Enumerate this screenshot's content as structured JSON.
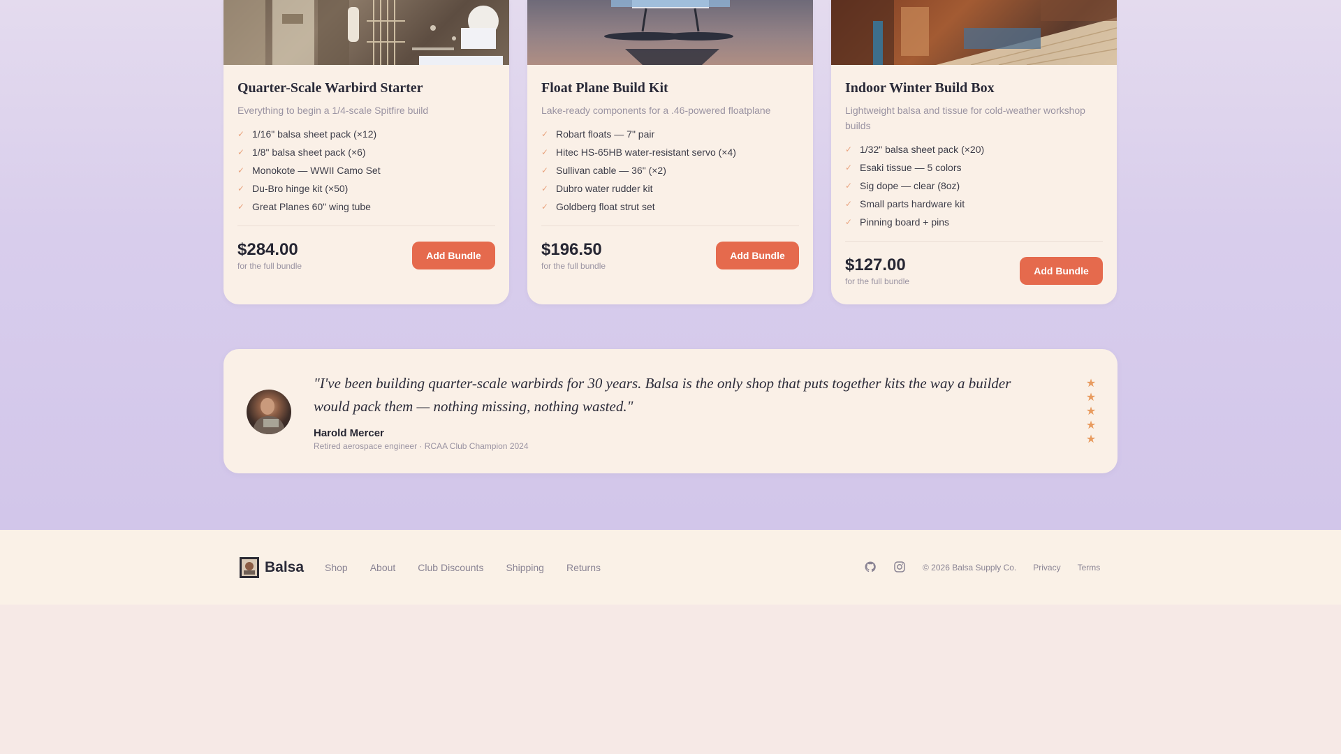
{
  "products": [
    {
      "title": "Quarter-Scale Warbird Starter",
      "subtitle": "Everything to begin a 1/4-scale Spitfire build",
      "features": [
        "1/16\" balsa sheet pack (×12)",
        "1/8\" balsa sheet pack (×6)",
        "Monokote — WWII Camo Set",
        "Du-Bro hinge kit (×50)",
        "Great Planes 60\" wing tube"
      ],
      "price": "$284.00",
      "price_note": "for the full bundle",
      "button": "Add Bundle"
    },
    {
      "title": "Float Plane Build Kit",
      "subtitle": "Lake-ready components for a .46-powered floatplane",
      "features": [
        "Robart floats — 7\" pair",
        "Hitec HS-65HB water-resistant servo (×4)",
        "Sullivan cable — 36\" (×2)",
        "Dubro water rudder kit",
        "Goldberg float strut set"
      ],
      "price": "$196.50",
      "price_note": "for the full bundle",
      "button": "Add Bundle"
    },
    {
      "title": "Indoor Winter Build Box",
      "subtitle": "Lightweight balsa and tissue for cold-weather workshop builds",
      "features": [
        "1/32\" balsa sheet pack (×20)",
        "Esaki tissue — 5 colors",
        "Sig dope — clear (8oz)",
        "Small parts hardware kit",
        "Pinning board + pins"
      ],
      "price": "$127.00",
      "price_note": "for the full bundle",
      "button": "Add Bundle"
    }
  ],
  "testimonial": {
    "quote": "\"I've been building quarter-scale warbirds for 30 years. Balsa is the only shop that puts together kits the way a builder would pack them — nothing missing, nothing wasted.\"",
    "author": "Harold Mercer",
    "role": "Retired aerospace engineer · RCAA Club Champion 2024",
    "rating": 5
  },
  "footer": {
    "brand": "Balsa",
    "nav": [
      "Shop",
      "About",
      "Club Discounts",
      "Shipping",
      "Returns"
    ],
    "social_icons": [
      "github-icon",
      "instagram-icon"
    ],
    "copyright": "© 2026 Balsa Supply Co.",
    "links": [
      "Privacy",
      "Terms"
    ]
  },
  "colors": {
    "accent": "#e56a4d",
    "star": "#e89b5f",
    "card_bg": "#faf0e7"
  }
}
